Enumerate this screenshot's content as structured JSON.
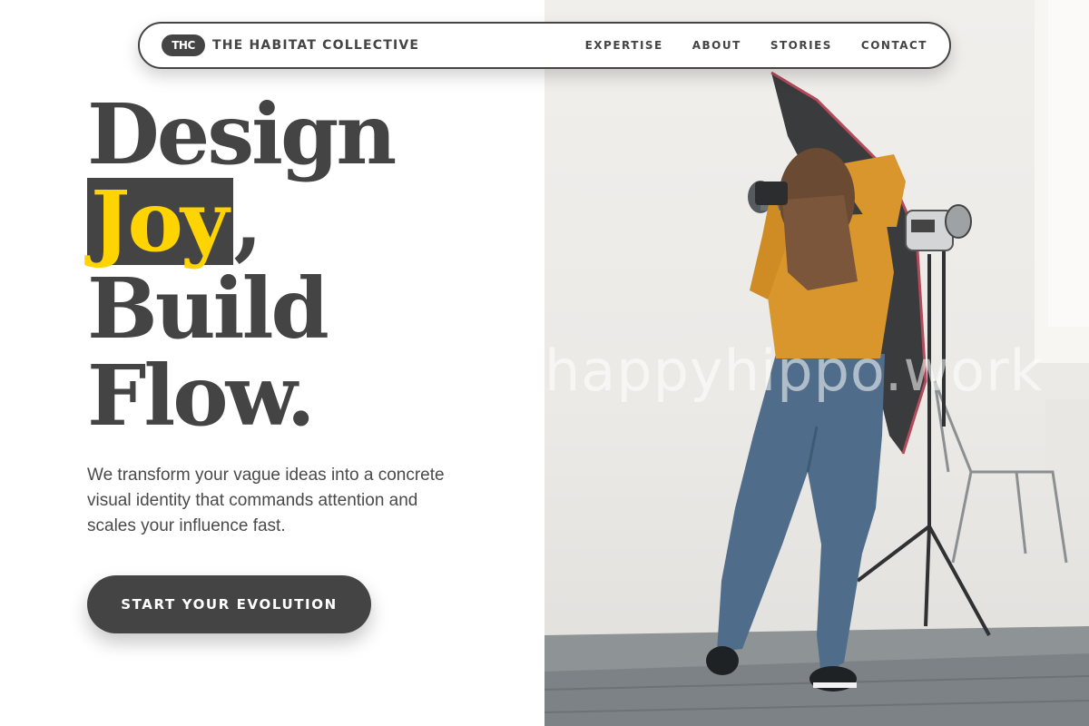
{
  "nav": {
    "logo_badge": "THC",
    "brand": "THE HABITAT COLLECTIVE",
    "links": [
      "EXPERTISE",
      "ABOUT",
      "STORIES",
      "CONTACT"
    ]
  },
  "hero": {
    "line1": "Design",
    "highlight": "Joy",
    "line2_suffix": ",",
    "line3": "Build",
    "line4": "Flow.",
    "lede": "We transform your vague ideas into a concrete visual identity that commands attention and scales your influence fast.",
    "cta": "START YOUR EVOLUTION"
  },
  "photo": {
    "watermark": "happyhippo.work",
    "alt": "Photographer in yellow top shooting in a bright studio with softbox lights"
  },
  "colors": {
    "primary": "#444444",
    "highlight": "#ffd400",
    "background": "#ffffff"
  }
}
